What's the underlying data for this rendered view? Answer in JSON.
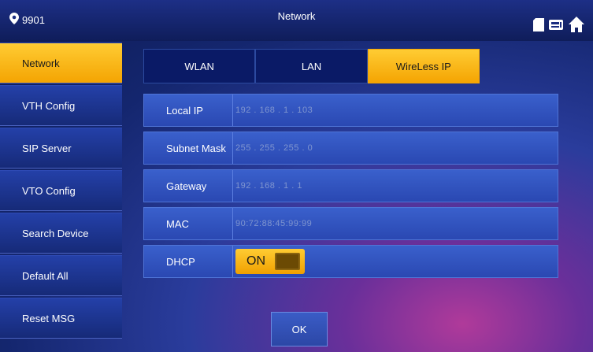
{
  "header": {
    "room_number": "9901",
    "title": "Network",
    "icons": [
      "location-pin-icon",
      "sd-card-icon",
      "intercom-icon",
      "home-icon"
    ]
  },
  "sidebar": {
    "items": [
      {
        "label": "Network",
        "active": true
      },
      {
        "label": "VTH Config",
        "active": false
      },
      {
        "label": "SIP Server",
        "active": false
      },
      {
        "label": "VTO Config",
        "active": false
      },
      {
        "label": "Search Device",
        "active": false
      },
      {
        "label": "Default All",
        "active": false
      },
      {
        "label": "Reset MSG",
        "active": false
      }
    ]
  },
  "tabs": [
    {
      "label": "WLAN",
      "active": false
    },
    {
      "label": "LAN",
      "active": false
    },
    {
      "label": "WireLess IP",
      "active": true
    }
  ],
  "form": {
    "local_ip": {
      "label": "Local IP",
      "value": "192 . 168 . 1 . 103"
    },
    "subnet_mask": {
      "label": "Subnet Mask",
      "value": "255 . 255 . 255 . 0"
    },
    "gateway": {
      "label": "Gateway",
      "value": "192 . 168 . 1 . 1"
    },
    "mac": {
      "label": "MAC",
      "value": "90:72:88:45:99:99"
    },
    "dhcp": {
      "label": "DHCP",
      "state": "ON"
    }
  },
  "ok_label": "OK",
  "colors": {
    "accent": "#f4a402",
    "sidebar_bg": "#1e3796",
    "row_bg": "#3556c0",
    "background": "#14266e"
  }
}
